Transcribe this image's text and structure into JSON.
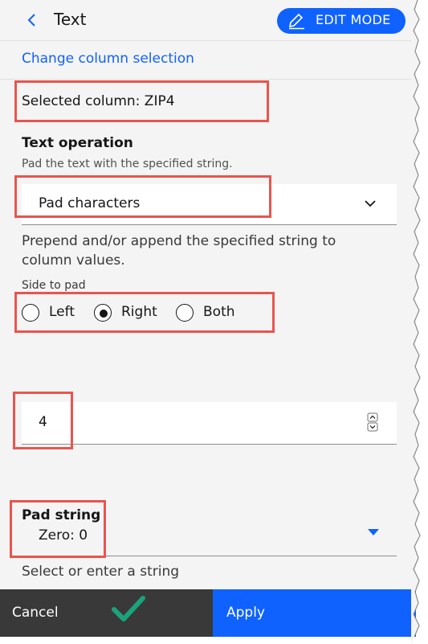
{
  "header": {
    "title": "Text",
    "edit_mode_label": "EDIT MODE"
  },
  "change_link": "Change column selection",
  "selected_column": "Selected column: ZIP4",
  "text_operation": {
    "label": "Text operation",
    "help": "Pad the text with the specified string.",
    "selected": "Pad characters"
  },
  "description": "Prepend and/or append the specified string to column values.",
  "side_to_pad": {
    "label": "Side to pad",
    "options": [
      "Left",
      "Right",
      "Both"
    ],
    "selected": "Right"
  },
  "length_value": "4",
  "pad_string": {
    "label": "Pad string",
    "value": "Zero: 0",
    "help": "Select or enter a string"
  },
  "footer": {
    "cancel_label": "Cancel",
    "apply_label": "Apply"
  },
  "colors": {
    "accent": "#0f62fe",
    "highlight": "#e8554e",
    "check": "#1aa37a"
  }
}
